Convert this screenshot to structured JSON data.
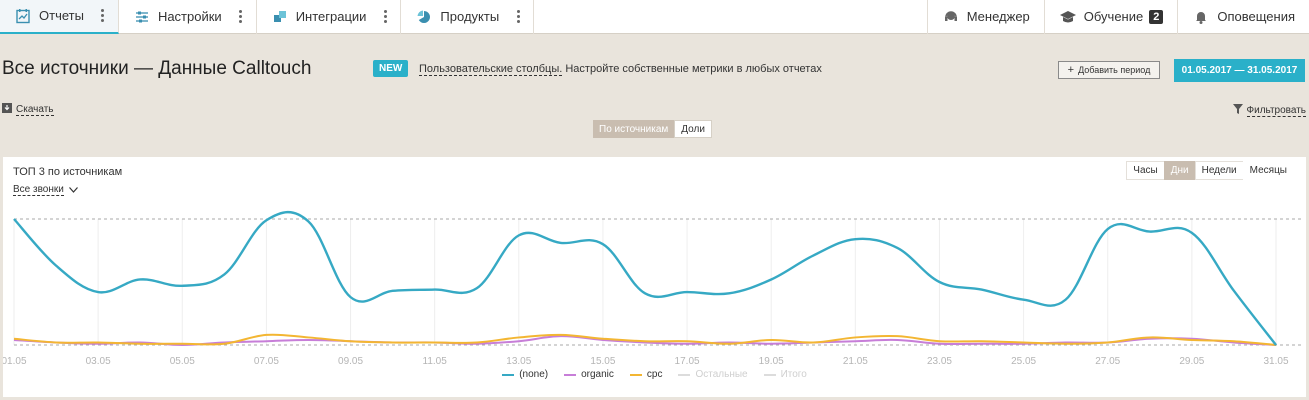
{
  "topnav": {
    "items": [
      {
        "label": "Отчеты",
        "icon": "calendar-report-icon"
      },
      {
        "label": "Настройки",
        "icon": "sliders-icon"
      },
      {
        "label": "Интеграции",
        "icon": "puzzle-icon"
      },
      {
        "label": "Продукты",
        "icon": "pie-icon"
      }
    ],
    "right": [
      {
        "label": "Менеджер",
        "icon": "headset-icon"
      },
      {
        "label": "Обучение",
        "icon": "graduation-cap-icon",
        "badge": "2"
      },
      {
        "label": "Оповещения",
        "icon": "bell-icon"
      }
    ]
  },
  "header": {
    "title": "Все источники — Данные Calltouch",
    "new_badge": "NEW",
    "promo_link": "Пользовательские столбцы.",
    "promo_text": " Настройте собственные метрики в любых отчетах",
    "add_period": "Добавить период",
    "date_range": "01.05.2017  —  31.05.2017"
  },
  "toolbar": {
    "download": "Скачать",
    "filter": "Фильтровать",
    "view_by_source": "По источникам",
    "view_shares": "Доли"
  },
  "panel": {
    "title": "ТОП 3 по источникам",
    "calls_filter": "Все звонки",
    "granularity": [
      "Часы",
      "Дни",
      "Недели",
      "Месяцы"
    ],
    "granularity_selected": "Дни"
  },
  "colors": {
    "accent": "#2ab0c9",
    "none": "#36a9c4",
    "organic": "#c77ed8",
    "cpc": "#f3b632"
  },
  "chart_data": {
    "type": "line",
    "x": [
      "01.05",
      "02.05",
      "03.05",
      "04.05",
      "05.05",
      "06.05",
      "07.05",
      "08.05",
      "09.05",
      "10.05",
      "11.05",
      "12.05",
      "13.05",
      "14.05",
      "15.05",
      "16.05",
      "17.05",
      "18.05",
      "19.05",
      "20.05",
      "21.05",
      "22.05",
      "23.05",
      "24.05",
      "25.05",
      "26.05",
      "27.05",
      "28.05",
      "29.05",
      "30.05",
      "31.05"
    ],
    "xtick_labels": [
      "01.05",
      "03.05",
      "05.05",
      "07.05",
      "09.05",
      "11.05",
      "13.05",
      "15.05",
      "17.05",
      "19.05",
      "21.05",
      "23.05",
      "25.05",
      "27.05",
      "29.05",
      "31.05"
    ],
    "ylim": [
      0,
      100
    ],
    "grid": true,
    "series": [
      {
        "name": "(none)",
        "values": [
          100,
          63,
          42,
          52,
          47,
          56,
          99,
          98,
          38,
          43,
          44,
          45,
          87,
          81,
          80,
          41,
          42,
          41,
          52,
          71,
          84,
          77,
          50,
          44,
          36,
          36,
          92,
          90,
          89,
          43,
          0
        ]
      },
      {
        "name": "organic",
        "values": [
          4,
          2,
          1,
          2,
          0,
          2,
          3,
          4,
          3,
          2,
          2,
          1,
          3,
          7,
          4,
          2,
          1,
          2,
          1,
          2,
          3,
          4,
          1,
          1,
          1,
          2,
          2,
          5,
          5,
          2,
          0
        ]
      },
      {
        "name": "cpc",
        "values": [
          5,
          2,
          2,
          1,
          1,
          1,
          8,
          6,
          3,
          2,
          2,
          2,
          6,
          8,
          5,
          3,
          3,
          1,
          4,
          2,
          6,
          7,
          3,
          3,
          2,
          1,
          2,
          6,
          4,
          3,
          0
        ]
      }
    ],
    "legend": [
      "(none)",
      "organic",
      "cpc",
      "Остальные",
      "Итого"
    ],
    "legend_hidden": [
      "Остальные",
      "Итого"
    ],
    "legend_position": "bottom"
  }
}
